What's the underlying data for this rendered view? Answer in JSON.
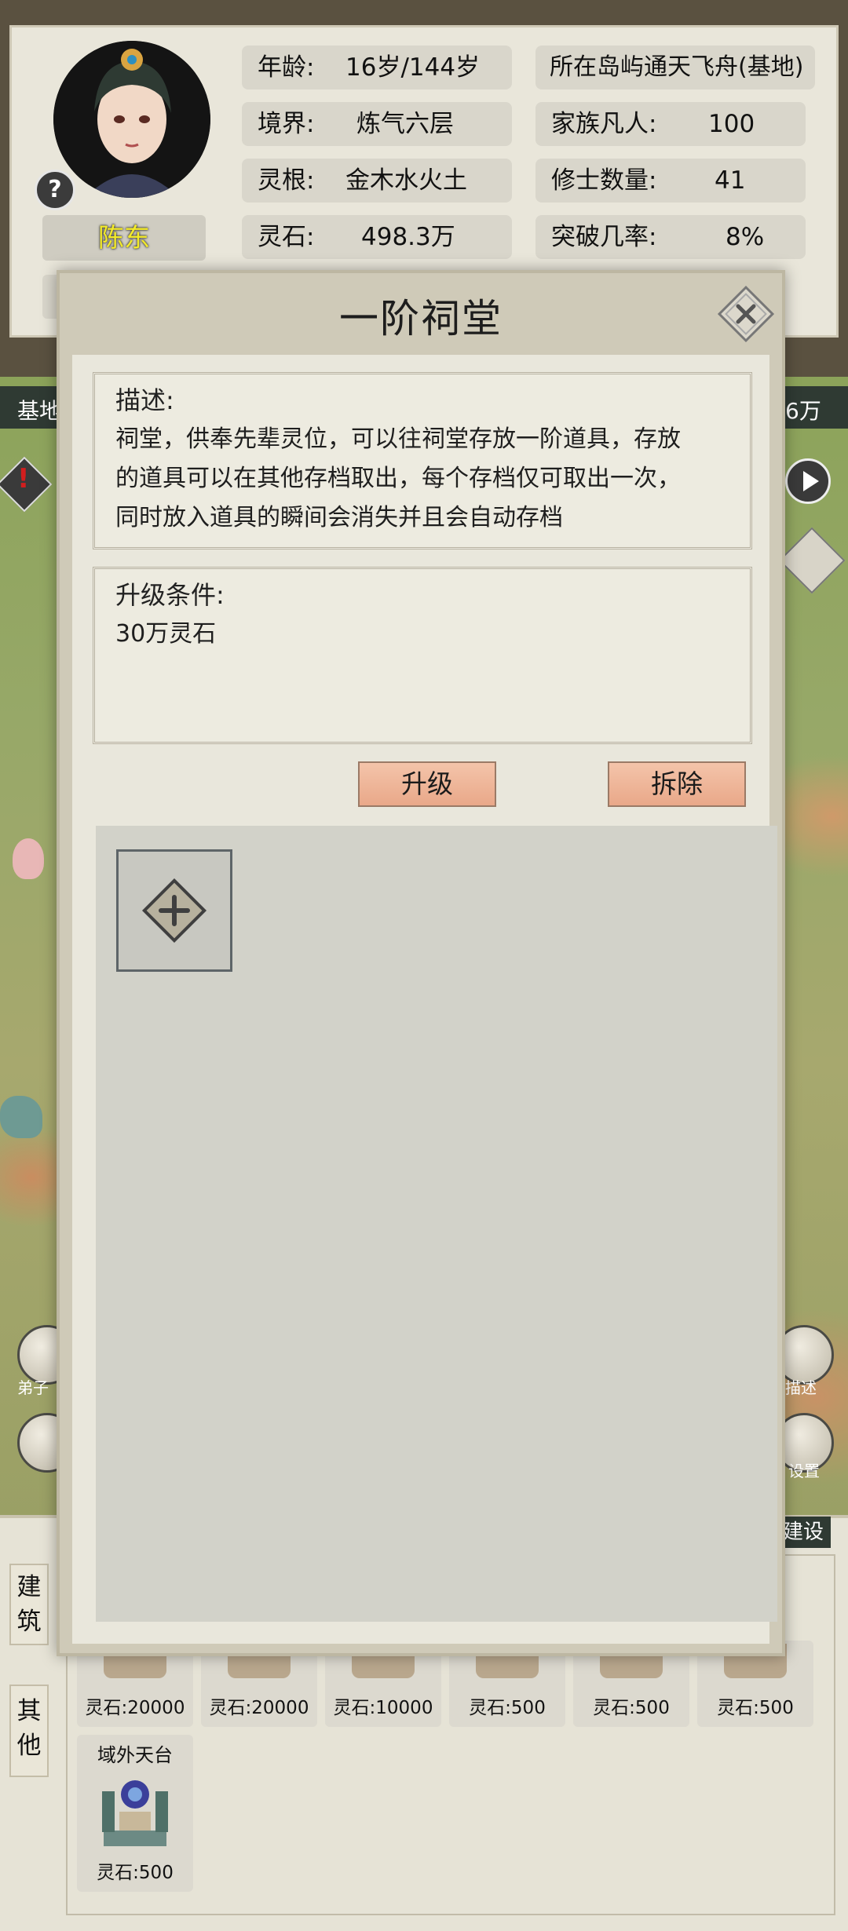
{
  "player": {
    "name": "陈东",
    "help": "?"
  },
  "stats": {
    "age_label": "年龄:",
    "age_value": "16岁/144岁",
    "realm_label": "境界:",
    "realm_value": "炼气六层",
    "root_label": "灵根:",
    "root_value": "金木水火土",
    "stone_label": "灵石:",
    "stone_value": "498.3万",
    "location": "所在岛屿通天飞舟(基地)",
    "mortals_label": "家族凡人:",
    "mortals_value": "100",
    "cultivators_label": "修士数量:",
    "cultivators_value": "41",
    "breakthrough_label": "突破几率:",
    "breakthrough_value": "8%"
  },
  "map": {
    "left_label": "基地",
    "right_label": "6万",
    "left_button_1": "弟子",
    "right_button_1": "描述",
    "right_button_2": "设置",
    "build_tab_right": "建设"
  },
  "dialog": {
    "title": "一阶祠堂",
    "desc_label": "描述:",
    "desc_lines": [
      "祠堂，供奉先辈灵位，可以往祠堂存放一阶道具，存放",
      "的道具可以在其他存档取出，每个存档仅可取出一次，",
      "同时放入道具的瞬间会消失并且会自动存档"
    ],
    "req_label": "升级条件:",
    "req_value": "30万灵石",
    "upgrade_label": "升级",
    "demolish_label": "拆除"
  },
  "bottom": {
    "tab_building": "建筑",
    "tab_other": "其他",
    "building_costs": [
      "灵石:20000",
      "灵石:20000",
      "灵石:10000",
      "灵石:500",
      "灵石:500",
      "灵石:500"
    ],
    "extra_building_name": "域外天台",
    "extra_building_cost": "灵石:500"
  },
  "colors": {
    "accent_button": "#eeb598",
    "name_text": "#f3ea2a",
    "dialog_bg": "#e9e7dc"
  }
}
